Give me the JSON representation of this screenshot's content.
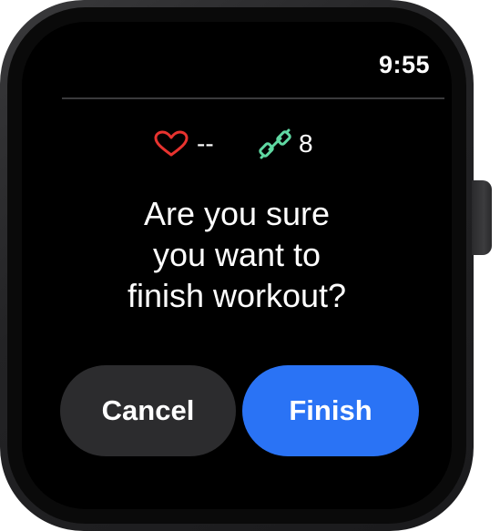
{
  "status": {
    "time": "9:55"
  },
  "stats": {
    "heart_rate": {
      "icon": "heart-icon",
      "value": "--",
      "color": "#e8332f"
    },
    "weight": {
      "icon": "dumbbell-icon",
      "value": "8",
      "color": "#5fd8a2"
    }
  },
  "dialog": {
    "question_line1": "Are you sure",
    "question_line2": "you want to",
    "question_line3": "finish workout?"
  },
  "actions": {
    "cancel_label": "Cancel",
    "finish_label": "Finish",
    "finish_color": "#2a73f5"
  }
}
